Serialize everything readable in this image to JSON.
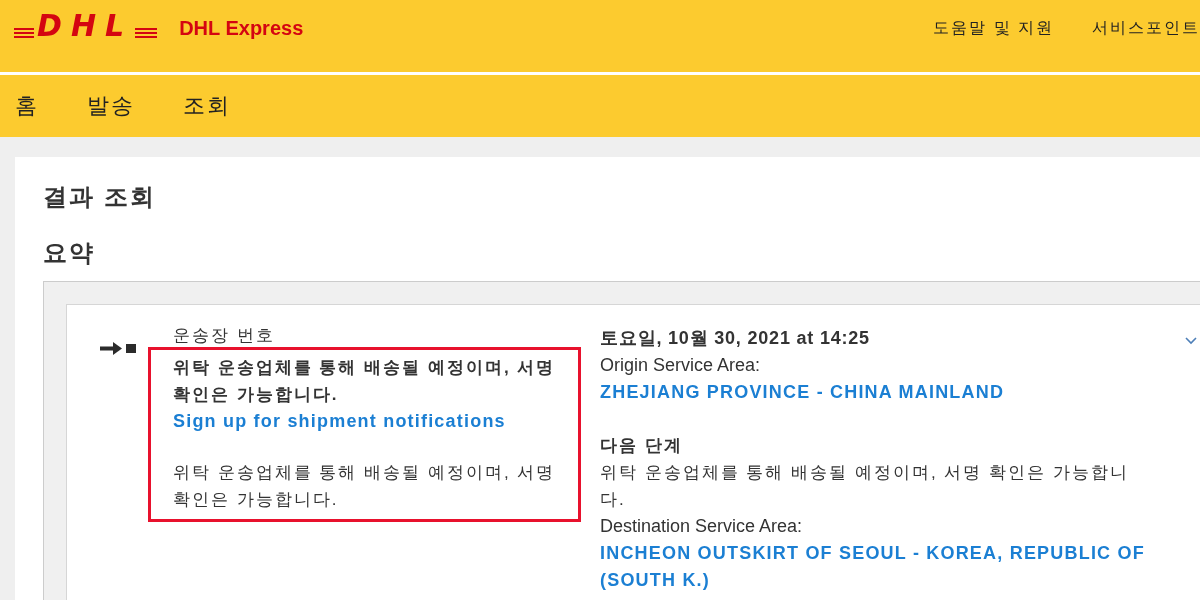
{
  "header": {
    "logo_text": "DHL",
    "brand": "DHL Express",
    "links": [
      {
        "label": "도움말 및 지원"
      },
      {
        "label": "서비스포인트"
      }
    ]
  },
  "nav": {
    "items": [
      {
        "label": "홈"
      },
      {
        "label": "발송"
      },
      {
        "label": "조회"
      }
    ]
  },
  "page": {
    "title": "결과 조회",
    "section": "요약"
  },
  "shipment": {
    "waybill_label": "운송장 번호",
    "highlighted": true,
    "status": "위탁 운송업체를 통해 배송될 예정이며, 서명 확인은 가능합니다.",
    "notify_link": "Sign up for shipment notifications",
    "status_detail": "위탁 운송업체를 통해 배송될 예정이며, 서명 확인은 가능합니다.",
    "event": {
      "date": "토요일, 10월 30, 2021 at 14:25",
      "origin_label": "Origin Service Area:",
      "origin": "ZHEJIANG PROVINCE - CHINA MAINLAND",
      "next_step_label": "다음 단계",
      "next_step": "위탁 운송업체를 통해 배송될 예정이며, 서명 확인은 가능합니다.",
      "destination_label": "Destination Service Area:",
      "destination": "INCHEON OUTSKIRT OF SEOUL - KOREA, REPUBLIC OF (SOUTH K.)"
    }
  }
}
